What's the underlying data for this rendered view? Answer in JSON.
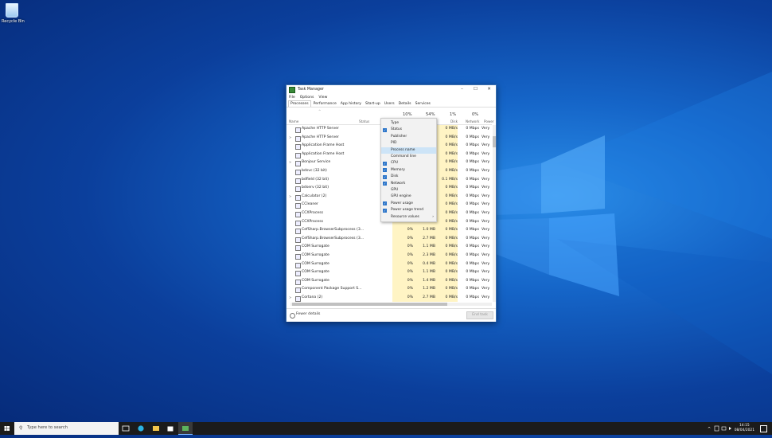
{
  "desktop": {
    "recycle_bin_label": "Recycle Bin"
  },
  "window": {
    "title": "Task Manager",
    "menu": [
      "File",
      "Options",
      "View"
    ],
    "tabs": [
      "Processes",
      "Performance",
      "App history",
      "Start-up",
      "Users",
      "Details",
      "Services"
    ],
    "active_tab": "Processes",
    "columns": {
      "name": "Name",
      "status": "Status",
      "cpu_pct": "10%",
      "memory_pct": "54%",
      "disk_pct": "1%",
      "disk": "Disk",
      "network_pct": "0%",
      "network": "Network",
      "power": "Power"
    },
    "rows": [
      {
        "name": "Apache HTTP Server",
        "expandable": false,
        "cpu": "",
        "memory": "",
        "disk": "0 MB/s",
        "network": "0 Mbps",
        "power": "Very"
      },
      {
        "name": "Apache HTTP Server",
        "expandable": true,
        "cpu": "",
        "memory": "",
        "disk": "0 MB/s",
        "network": "0 Mbps",
        "power": "Very"
      },
      {
        "name": "Application Frame Host",
        "expandable": false,
        "cpu": "",
        "memory": "",
        "disk": "0 MB/s",
        "network": "0 Mbps",
        "power": "Very"
      },
      {
        "name": "Application Frame Host",
        "expandable": false,
        "cpu": "",
        "memory": "",
        "disk": "0 MB/s",
        "network": "0 Mbps",
        "power": "Very"
      },
      {
        "name": "Bonjour Service",
        "expandable": true,
        "cpu": "",
        "memory": "",
        "disk": "0 MB/s",
        "network": "0 Mbps",
        "power": "Very"
      },
      {
        "name": "bdsvc (32 bit)",
        "expandable": false,
        "cpu": "",
        "memory": "",
        "disk": "0 MB/s",
        "network": "0 Mbps",
        "power": "Very"
      },
      {
        "name": "bdfield (32 bit)",
        "expandable": false,
        "cpu": "",
        "memory": "",
        "disk": "0.1 MB/s",
        "network": "0 Mbps",
        "power": "Very"
      },
      {
        "name": "bdserv (32 bit)",
        "expandable": false,
        "cpu": "",
        "memory": "",
        "disk": "0 MB/s",
        "network": "0 Mbps",
        "power": "Very"
      },
      {
        "name": "Calculator (2)",
        "expandable": true,
        "cpu": "",
        "memory": "",
        "disk": "0 MB/s",
        "network": "0 Mbps",
        "power": "Very"
      },
      {
        "name": "CCleaner",
        "expandable": false,
        "cpu": "",
        "memory": "",
        "disk": "0 MB/s",
        "network": "0 Mbps",
        "power": "Very"
      },
      {
        "name": "CCXProcess",
        "expandable": false,
        "cpu": "",
        "memory": "",
        "disk": "0 MB/s",
        "network": "0 Mbps",
        "power": "Very"
      },
      {
        "name": "CCXProcess",
        "expandable": false,
        "cpu": "",
        "memory": "",
        "disk": "0 MB/s",
        "network": "0 Mbps",
        "power": "Very"
      },
      {
        "name": "CefSharp.BrowserSubprocess (3...",
        "expandable": false,
        "cpu": "0%",
        "memory": "1.0 MB",
        "disk": "0 MB/s",
        "network": "0 Mbps",
        "power": "Very"
      },
      {
        "name": "CefSharp.BrowserSubprocess (3...",
        "expandable": false,
        "cpu": "0%",
        "memory": "2.7 MB",
        "disk": "0 MB/s",
        "network": "0 Mbps",
        "power": "Very"
      },
      {
        "name": "COM Surrogate",
        "expandable": false,
        "cpu": "0%",
        "memory": "1.1 MB",
        "disk": "0 MB/s",
        "network": "0 Mbps",
        "power": "Very"
      },
      {
        "name": "COM Surrogate",
        "expandable": false,
        "cpu": "0%",
        "memory": "2.3 MB",
        "disk": "0 MB/s",
        "network": "0 Mbps",
        "power": "Very"
      },
      {
        "name": "COM Surrogate",
        "expandable": false,
        "cpu": "0%",
        "memory": "0.4 MB",
        "disk": "0 MB/s",
        "network": "0 Mbps",
        "power": "Very"
      },
      {
        "name": "COM Surrogate",
        "expandable": false,
        "cpu": "0%",
        "memory": "1.1 MB",
        "disk": "0 MB/s",
        "network": "0 Mbps",
        "power": "Very"
      },
      {
        "name": "COM Surrogate",
        "expandable": false,
        "cpu": "0%",
        "memory": "1.4 MB",
        "disk": "0 MB/s",
        "network": "0 Mbps",
        "power": "Very"
      },
      {
        "name": "Component Package Support S...",
        "expandable": false,
        "cpu": "0%",
        "memory": "1.2 MB",
        "disk": "0 MB/s",
        "network": "0 Mbps",
        "power": "Very"
      },
      {
        "name": "Cortana (2)",
        "expandable": true,
        "cpu": "0%",
        "memory": "2.7 MB",
        "disk": "0 MB/s",
        "network": "0 Mbps",
        "power": "Very"
      }
    ],
    "footer": {
      "fewer_details": "Fewer details",
      "end_task": "End task"
    }
  },
  "context_menu": {
    "items": [
      {
        "label": "Type",
        "checked": false
      },
      {
        "label": "Status",
        "checked": true
      },
      {
        "label": "Publisher",
        "checked": false
      },
      {
        "label": "PID",
        "checked": false
      },
      {
        "label": "Process name",
        "checked": false,
        "highlighted": true
      },
      {
        "label": "Command line",
        "checked": false
      },
      {
        "label": "CPU",
        "checked": true
      },
      {
        "label": "Memory",
        "checked": true
      },
      {
        "label": "Disk",
        "checked": true
      },
      {
        "label": "Network",
        "checked": true
      },
      {
        "label": "GPU",
        "checked": false
      },
      {
        "label": "GPU engine",
        "checked": false
      },
      {
        "label": "Power usage",
        "checked": true
      },
      {
        "label": "Power usage trend",
        "checked": true
      },
      {
        "label": "Resource values",
        "checked": false,
        "submenu": true
      }
    ]
  },
  "taskbar": {
    "search_placeholder": "Type here to search",
    "time": "14:15",
    "date": "08/04/2021",
    "accent": "#7ab4ff"
  }
}
